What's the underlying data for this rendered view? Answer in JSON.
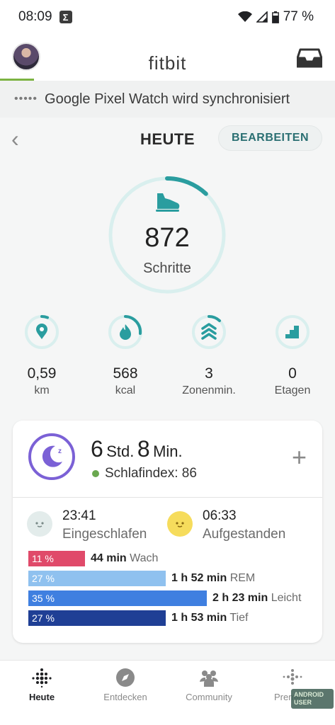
{
  "status_bar": {
    "time": "08:09",
    "notification_icon": "Σ",
    "battery": "77 %"
  },
  "header": {
    "brand": "fitbit"
  },
  "sync": {
    "text": "Google Pixel Watch wird synchronisiert"
  },
  "day": {
    "title": "HEUTE",
    "edit_label": "BEARBEITEN"
  },
  "steps": {
    "value": "872",
    "label": "Schritte",
    "progress": 0.12
  },
  "stats": [
    {
      "value": "0,59",
      "label": "km",
      "icon": "location-pin-icon"
    },
    {
      "value": "568",
      "label": "kcal",
      "icon": "flame-icon"
    },
    {
      "value": "3",
      "label": "Zonenmin.",
      "icon": "zone-chevrons-icon"
    },
    {
      "value": "0",
      "label": "Etagen",
      "icon": "stairs-icon"
    }
  ],
  "sleep": {
    "hours": "6",
    "hours_unit": "Std.",
    "minutes": "8",
    "minutes_unit": "Min.",
    "score_text": "Schlafindex: 86",
    "asleep_time": "23:41",
    "asleep_label": "Eingeschlafen",
    "awake_time": "06:33",
    "awake_label": "Aufgestanden",
    "stages": [
      {
        "percent": "11 %",
        "duration": "44 min",
        "name": "Wach",
        "color": "#e04a6a"
      },
      {
        "percent": "27 %",
        "duration": "1 h 52 min",
        "name": "REM",
        "color": "#8fc1ef"
      },
      {
        "percent": "35 %",
        "duration": "2 h 23 min",
        "name": "Leicht",
        "color": "#3f7fe0"
      },
      {
        "percent": "27 %",
        "duration": "1 h 53 min",
        "name": "Tief",
        "color": "#1f3f95"
      }
    ]
  },
  "nav": [
    {
      "label": "Heute",
      "active": true
    },
    {
      "label": "Entdecken",
      "active": false
    },
    {
      "label": "Community",
      "active": false
    },
    {
      "label": "Premium",
      "active": false
    }
  ],
  "watermark": {
    "line1": "ANDROID",
    "line2": "USER"
  },
  "colors": {
    "accent": "#2a9d9f",
    "ring_track": "#d9efee",
    "green": "#7cb342"
  }
}
